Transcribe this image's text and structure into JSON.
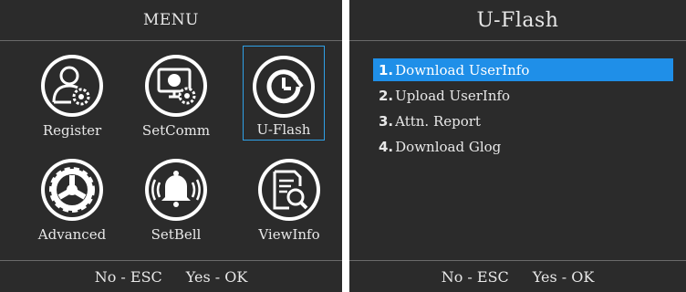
{
  "left": {
    "title": "MENU",
    "tiles": [
      {
        "label": "Register",
        "icon": "register-icon",
        "selected": false
      },
      {
        "label": "SetComm",
        "icon": "setcomm-icon",
        "selected": false
      },
      {
        "label": "U-Flash",
        "icon": "clock-icon",
        "selected": true
      },
      {
        "label": "Advanced",
        "icon": "gear-icon",
        "selected": false
      },
      {
        "label": "SetBell",
        "icon": "bell-icon",
        "selected": false
      },
      {
        "label": "ViewInfo",
        "icon": "document-search-icon",
        "selected": false
      }
    ],
    "footer": {
      "no": "No - ESC",
      "yes": "Yes - OK"
    }
  },
  "right": {
    "title": "U-Flash",
    "items": [
      {
        "num": "1.",
        "label": "Download UserInfo",
        "active": true
      },
      {
        "num": "2.",
        "label": "Upload UserInfo",
        "active": false
      },
      {
        "num": "3.",
        "label": "Attn. Report",
        "active": false
      },
      {
        "num": "4.",
        "label": "Download Glog",
        "active": false
      }
    ],
    "footer": {
      "no": "No - ESC",
      "yes": "Yes - OK"
    }
  },
  "colors": {
    "background": "#2b2b2b",
    "text": "#e8e8e8",
    "highlight": "#1f8fe8",
    "selection_border": "#2fa0e6",
    "divider": "#6a6a6a"
  }
}
